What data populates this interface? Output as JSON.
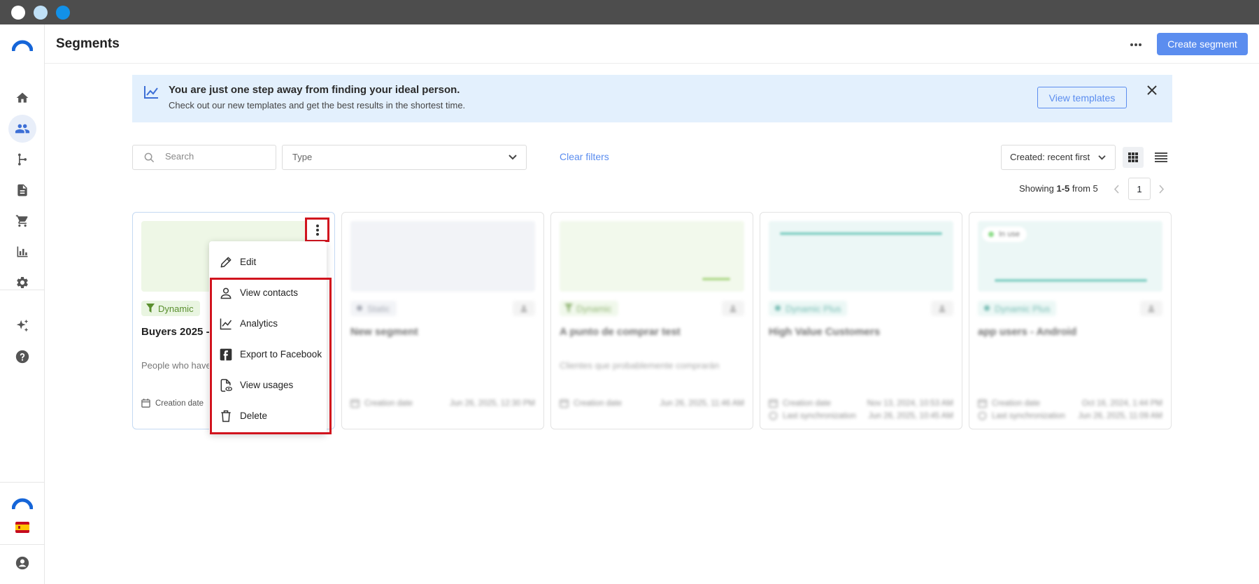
{
  "app": {
    "page_title": "Segments",
    "more_icon": "more-horizontal-icon",
    "create_label": "Create segment"
  },
  "sidebar": {
    "logo_icon": "brand-logo-icon",
    "items": [
      {
        "name": "home",
        "icon": "home-icon"
      },
      {
        "name": "contacts",
        "icon": "people-icon",
        "active": true
      },
      {
        "name": "journeys",
        "icon": "branch-icon"
      },
      {
        "name": "content",
        "icon": "document-icon"
      },
      {
        "name": "ecommerce",
        "icon": "cart-icon"
      },
      {
        "name": "analytics",
        "icon": "bar-chart-icon"
      },
      {
        "name": "settings",
        "icon": "gear-icon"
      },
      {
        "name": "ai",
        "icon": "sparkles-icon"
      },
      {
        "name": "help",
        "icon": "help-icon"
      }
    ],
    "account_icons": [
      "brand-logo-icon",
      "spain-flag-icon",
      "user-icon"
    ]
  },
  "banner": {
    "title": "You are just one step away from finding your ideal person.",
    "subtitle": "Check out our new templates and get the best results in the shortest time.",
    "button": "View templates"
  },
  "filters": {
    "search_placeholder": "Search",
    "type_placeholder": "Type",
    "clear": "Clear filters",
    "sort": "Created: recent first"
  },
  "pagination": {
    "showing_prefix": "Showing ",
    "range": "1-5",
    "showing_suffix": " from 5",
    "page": "1"
  },
  "cards": [
    {
      "badge": "Dynamic",
      "title": "Buyers 2025 - ",
      "description": "People who have",
      "date_label": "Creation date",
      "thumb_color": "#eef7e6",
      "badge_bg": "#e9f5e1",
      "badge_color": "#5a8f2e"
    },
    {
      "badge": "Static",
      "title": "New segment",
      "description": "",
      "date_label": "Creation date",
      "date_value": "Jun 26, 2025, 12:30 PM",
      "thumb_color": "#eef0f5",
      "badge_bg": "#eceef3",
      "badge_color": "#7a8090"
    },
    {
      "badge": "Dynamic",
      "title": "A punto de comprar test",
      "description": "Clientes que probablemente comprarán",
      "date_label": "Creation date",
      "date_value": "Jun 26, 2025, 11:46 AM",
      "thumb_color": "#eef7e6",
      "badge_bg": "#e9f5e1",
      "badge_color": "#5a8f2e"
    },
    {
      "badge": "Dynamic Plus",
      "title": "High Value Customers",
      "description": "",
      "date_label": "Creation date",
      "date_value": "Nov 13, 2024, 10:53 AM",
      "last_label": "Last synchronization",
      "last_value": "Jun 26, 2025, 10:45 AM",
      "thumb_color": "#e6f5f3",
      "badge_bg": "#e2f4f1",
      "badge_color": "#2f9a8c"
    },
    {
      "badge": "Dynamic Plus",
      "title": "app users - Android",
      "description": "",
      "date_label": "Creation date",
      "date_value": "Oct 16, 2024, 1:44 PM",
      "last_label": "Last synchronization",
      "last_value": "Jun 26, 2025, 11:09 AM",
      "thumb_color": "#e6f5f3",
      "badge_bg": "#e2f4f1",
      "badge_color": "#2f9a8c",
      "status": "In use"
    }
  ],
  "menu": {
    "items": [
      {
        "label": "Edit",
        "icon": "pencil-icon"
      },
      {
        "label": "View contacts",
        "icon": "person-icon"
      },
      {
        "label": "Analytics",
        "icon": "line-chart-icon"
      },
      {
        "label": "Export to Facebook",
        "icon": "facebook-icon"
      },
      {
        "label": "View usages",
        "icon": "file-eye-icon"
      },
      {
        "label": "Delete",
        "icon": "trash-icon"
      }
    ]
  },
  "colors": {
    "accent": "#5b8def",
    "highlight": "#d1141e",
    "banner_bg": "#e3f0fd"
  }
}
